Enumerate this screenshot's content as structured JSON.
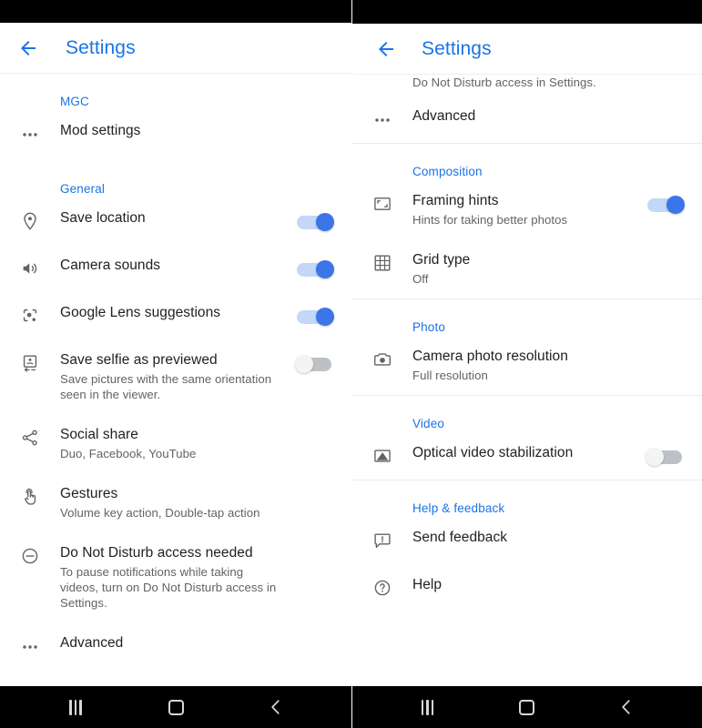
{
  "left": {
    "appbar": {
      "title": "Settings",
      "back_icon": "arrow-left-icon"
    },
    "sections": [
      {
        "header": "MGC",
        "items": [
          {
            "icon": "more-horiz-icon",
            "title": "Mod settings",
            "sub": "",
            "control": "none"
          }
        ]
      },
      {
        "header": "General",
        "items": [
          {
            "icon": "location-pin-icon",
            "title": "Save location",
            "sub": "",
            "control": "switch",
            "state": "on"
          },
          {
            "icon": "volume-up-icon",
            "title": "Camera sounds",
            "sub": "",
            "control": "switch",
            "state": "on"
          },
          {
            "icon": "google-lens-icon",
            "title": "Google Lens suggestions",
            "sub": "",
            "control": "switch",
            "state": "on"
          },
          {
            "icon": "selfie-flip-icon",
            "title": "Save selfie as previewed",
            "sub": "Save pictures with the same orientation seen in the viewer.",
            "control": "switch",
            "state": "off"
          },
          {
            "icon": "share-icon",
            "title": "Social share",
            "sub": "Duo, Facebook, YouTube",
            "control": "none"
          },
          {
            "icon": "gesture-tap-icon",
            "title": "Gestures",
            "sub": "Volume key action, Double-tap action",
            "control": "none"
          },
          {
            "icon": "do-not-disturb-icon",
            "title": "Do Not Disturb access needed",
            "sub": "To pause notifications while taking videos, turn on Do Not Disturb access in Settings.",
            "control": "none"
          },
          {
            "icon": "more-horiz-icon",
            "title": "Advanced",
            "sub": "",
            "control": "none"
          }
        ]
      }
    ],
    "navbar": {
      "recents": "recents-icon",
      "home": "home-icon",
      "back": "back-icon"
    }
  },
  "right": {
    "appbar": {
      "title": "Settings",
      "back_icon": "arrow-left-icon"
    },
    "cut_text": "Do Not Disturb access in Settings.",
    "top_items": [
      {
        "icon": "more-horiz-icon",
        "title": "Advanced",
        "sub": "",
        "control": "none"
      }
    ],
    "sections": [
      {
        "header": "Composition",
        "items": [
          {
            "icon": "framing-hints-icon",
            "title": "Framing hints",
            "sub": "Hints for taking better photos",
            "control": "switch",
            "state": "on"
          },
          {
            "icon": "grid-icon",
            "title": "Grid type",
            "sub": "Off",
            "control": "none"
          }
        ]
      },
      {
        "header": "Photo",
        "items": [
          {
            "icon": "camera-icon",
            "title": "Camera photo resolution",
            "sub": "Full resolution",
            "control": "none"
          }
        ]
      },
      {
        "header": "Video",
        "items": [
          {
            "icon": "video-stabilization-icon",
            "title": "Optical video stabilization",
            "sub": "",
            "control": "switch",
            "state": "off"
          }
        ]
      },
      {
        "header": "Help & feedback",
        "items": [
          {
            "icon": "feedback-icon",
            "title": "Send feedback",
            "sub": "",
            "control": "none"
          },
          {
            "icon": "help-icon",
            "title": "Help",
            "sub": "",
            "control": "none"
          }
        ]
      }
    ],
    "navbar": {
      "recents": "recents-icon",
      "home": "home-icon",
      "back": "back-icon"
    }
  },
  "colors": {
    "accent_blue": "#1a73e8",
    "switch_on_thumb": "#3b76e8",
    "switch_on_track": "#c3d7f7",
    "switch_off_thumb": "#f4f4f4",
    "switch_off_track": "#bdc1c6",
    "primary_text": "#202124",
    "secondary_text": "#5f6368",
    "divider": "#e8eaed",
    "statusbar": "#000000"
  }
}
